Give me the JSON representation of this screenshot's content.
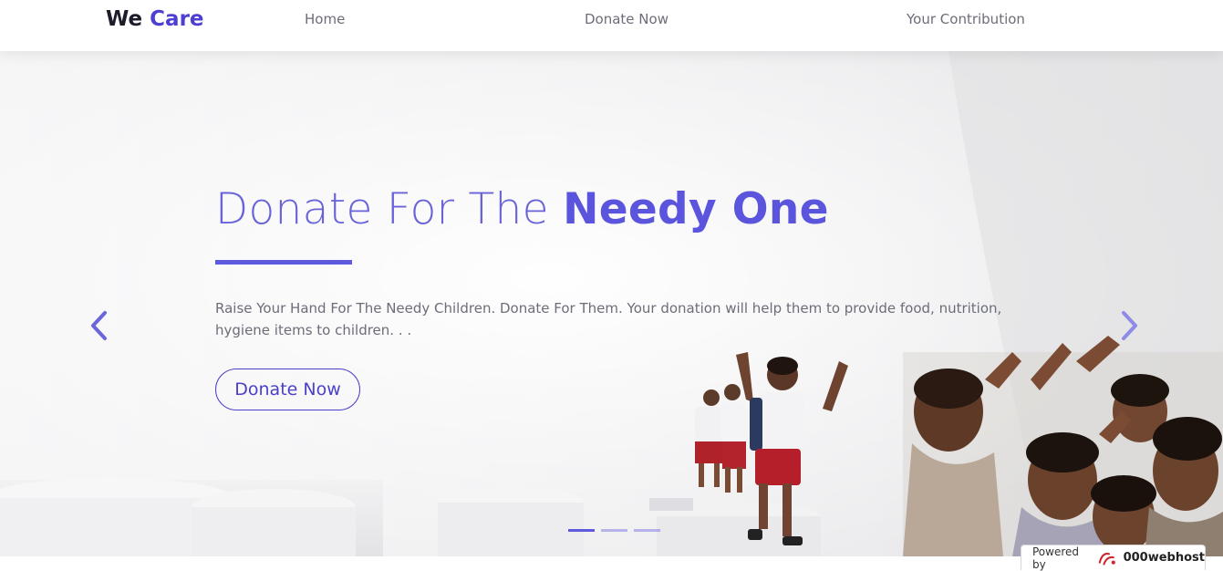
{
  "brand": {
    "part1": "We",
    "part2": "Care"
  },
  "nav": {
    "home": "Home",
    "donate": "Donate Now",
    "contribution": "Your Contribution"
  },
  "hero": {
    "headline_light": "Donate For The ",
    "headline_bold": "Needy One",
    "description": "Raise Your Hand For The Needy Children. Donate For Them. Your donation will help them to provide food, nutrition, hygiene items to children. . .",
    "cta_label": "Donate Now",
    "prev_icon": "chevron-left-icon",
    "next_icon": "chevron-right-icon",
    "slides": {
      "total": 3,
      "active": 1
    }
  },
  "badge": {
    "label": "Powered by",
    "host": "000webhost"
  },
  "colors": {
    "accent": "#5e5ade",
    "brand_accent": "#4c3fd1",
    "text_muted": "#6c6d79"
  }
}
